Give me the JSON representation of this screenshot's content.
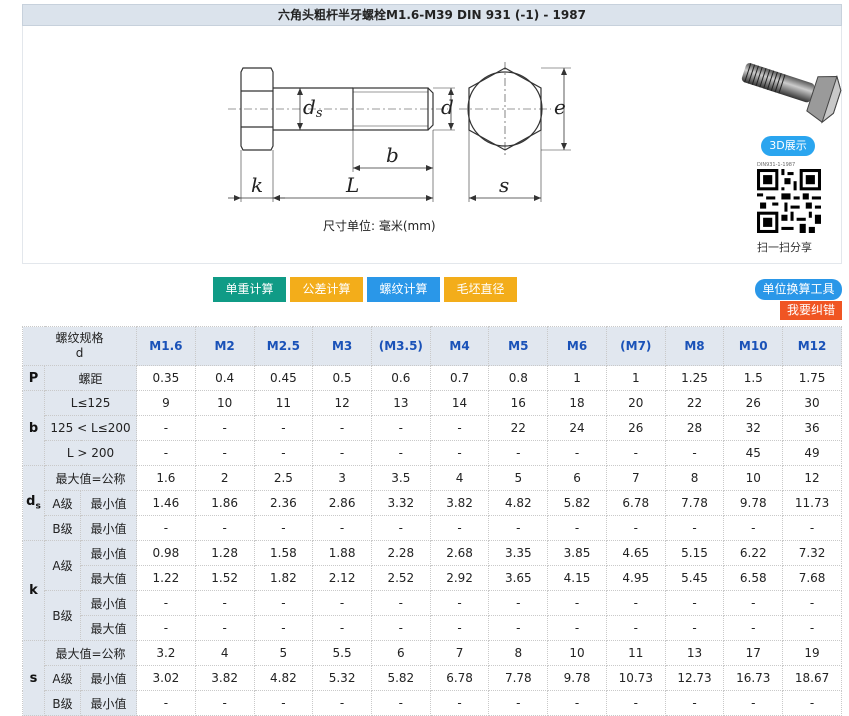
{
  "title": "六角头粗杆半牙螺栓M1.6-M39 DIN 931 (-1) - 1987",
  "diagram": {
    "labels": {
      "ds": "ds",
      "d": "d",
      "e": "e",
      "b": "b",
      "k": "k",
      "L": "L",
      "s": "s"
    },
    "unit_text": "尺寸单位: 毫米(mm)"
  },
  "side": {
    "btn_3d": "3D展示",
    "qr_code_top": "DIN931-1-1987",
    "qr_caption": "扫一扫分享"
  },
  "toolbar": {
    "weight_calc": "单重计算",
    "tolerance_calc": "公差计算",
    "thread_calc": "螺纹计算",
    "blank_dia": "毛坯直径"
  },
  "unit_convert": "单位换算工具",
  "report_error": "我要纠错",
  "table": {
    "spec_label_line1": "螺纹规格",
    "spec_label_line2": "d",
    "sizes": [
      "M1.6",
      "M2",
      "M2.5",
      "M3",
      "(M3.5)",
      "M4",
      "M5",
      "M6",
      "(M7)",
      "M8",
      "M10",
      "M12"
    ],
    "rows": {
      "P": {
        "sym": "P",
        "label": "螺距",
        "values": [
          "0.35",
          "0.4",
          "0.45",
          "0.5",
          "0.6",
          "0.7",
          "0.8",
          "1",
          "1",
          "1.25",
          "1.5",
          "1.75"
        ]
      },
      "b1": {
        "sym": "b",
        "label": "L≤125",
        "values": [
          "9",
          "10",
          "11",
          "12",
          "13",
          "14",
          "16",
          "18",
          "20",
          "22",
          "26",
          "30"
        ]
      },
      "b2": {
        "label": "125 < L≤200",
        "values": [
          "-",
          "-",
          "-",
          "-",
          "-",
          "-",
          "22",
          "24",
          "26",
          "28",
          "32",
          "36"
        ]
      },
      "b3": {
        "label": "L > 200",
        "values": [
          "-",
          "-",
          "-",
          "-",
          "-",
          "-",
          "-",
          "-",
          "-",
          "-",
          "45",
          "49"
        ]
      },
      "ds1": {
        "sym": "d",
        "sym_sub": "s",
        "label": "最大值=公称",
        "values": [
          "1.6",
          "2",
          "2.5",
          "3",
          "3.5",
          "4",
          "5",
          "6",
          "7",
          "8",
          "10",
          "12"
        ]
      },
      "ds2": {
        "grade": "A级",
        "label": "最小值",
        "values": [
          "1.46",
          "1.86",
          "2.36",
          "2.86",
          "3.32",
          "3.82",
          "4.82",
          "5.82",
          "6.78",
          "7.78",
          "9.78",
          "11.73"
        ]
      },
      "ds3": {
        "grade": "B级",
        "label": "最小值",
        "values": [
          "-",
          "-",
          "-",
          "-",
          "-",
          "-",
          "-",
          "-",
          "-",
          "-",
          "-",
          "-"
        ]
      },
      "k1": {
        "sym": "k",
        "grade": "A级",
        "label": "最小值",
        "values": [
          "0.98",
          "1.28",
          "1.58",
          "1.88",
          "2.28",
          "2.68",
          "3.35",
          "3.85",
          "4.65",
          "5.15",
          "6.22",
          "7.32"
        ]
      },
      "k2": {
        "label": "最大值",
        "values": [
          "1.22",
          "1.52",
          "1.82",
          "2.12",
          "2.52",
          "2.92",
          "3.65",
          "4.15",
          "4.95",
          "5.45",
          "6.58",
          "7.68"
        ]
      },
      "k3": {
        "grade": "B级",
        "label": "最小值",
        "values": [
          "-",
          "-",
          "-",
          "-",
          "-",
          "-",
          "-",
          "-",
          "-",
          "-",
          "-",
          "-"
        ]
      },
      "k4": {
        "label": "最大值",
        "values": [
          "-",
          "-",
          "-",
          "-",
          "-",
          "-",
          "-",
          "-",
          "-",
          "-",
          "-",
          "-"
        ]
      },
      "s1": {
        "sym": "s",
        "label": "最大值=公称",
        "values": [
          "3.2",
          "4",
          "5",
          "5.5",
          "6",
          "7",
          "8",
          "10",
          "11",
          "13",
          "17",
          "19"
        ]
      },
      "s2": {
        "grade": "A级",
        "label": "最小值",
        "values": [
          "3.02",
          "3.82",
          "4.82",
          "5.32",
          "5.82",
          "6.78",
          "7.78",
          "9.78",
          "10.73",
          "12.73",
          "16.73",
          "18.67"
        ]
      },
      "s3": {
        "grade": "B级",
        "label": "最小值",
        "values": [
          "-",
          "-",
          "-",
          "-",
          "-",
          "-",
          "-",
          "-",
          "-",
          "-",
          "-",
          "-"
        ]
      }
    }
  },
  "colors": {
    "header_bg": "#e1e7ef",
    "size_text": "#1a52b8",
    "teal": "#109b86",
    "orange": "#f3ad1a",
    "blue": "#2a97e8",
    "red": "#f05523"
  }
}
